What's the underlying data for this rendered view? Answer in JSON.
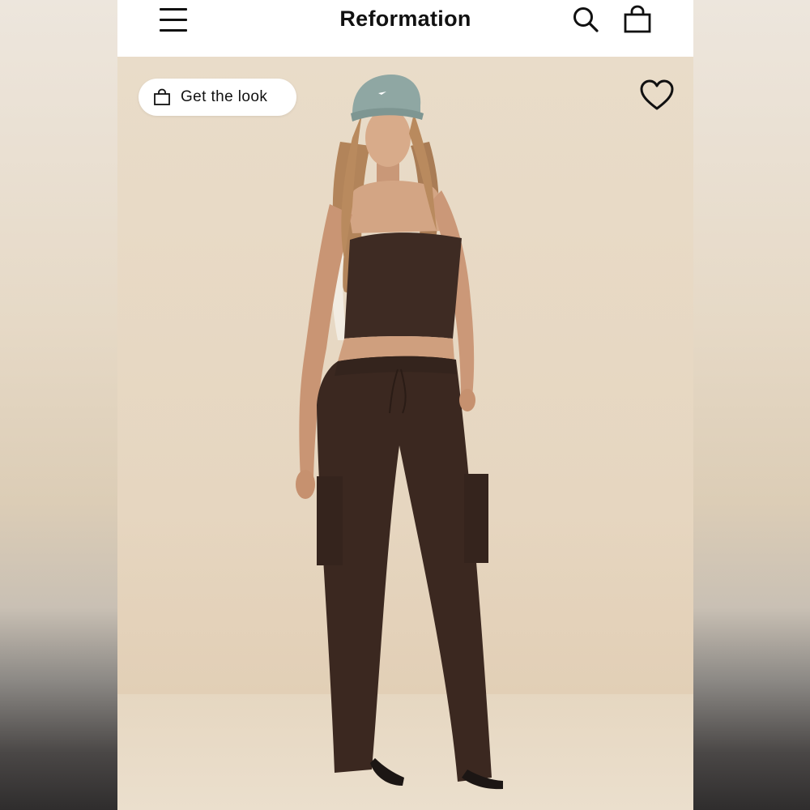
{
  "header": {
    "brand": "Reformation",
    "menu_icon": "hamburger-menu-icon",
    "search_icon": "search-icon",
    "bag_icon": "shopping-bag-icon"
  },
  "hero": {
    "get_the_look_label": "Get the look",
    "get_the_look_icon": "shopping-bag-icon",
    "favorite_icon": "heart-icon"
  },
  "colors": {
    "header_bg": "#ffffff",
    "text": "#111111",
    "background": "#e7d8c3",
    "garment": "#3d2a22",
    "cap": "#8fa7a3"
  }
}
